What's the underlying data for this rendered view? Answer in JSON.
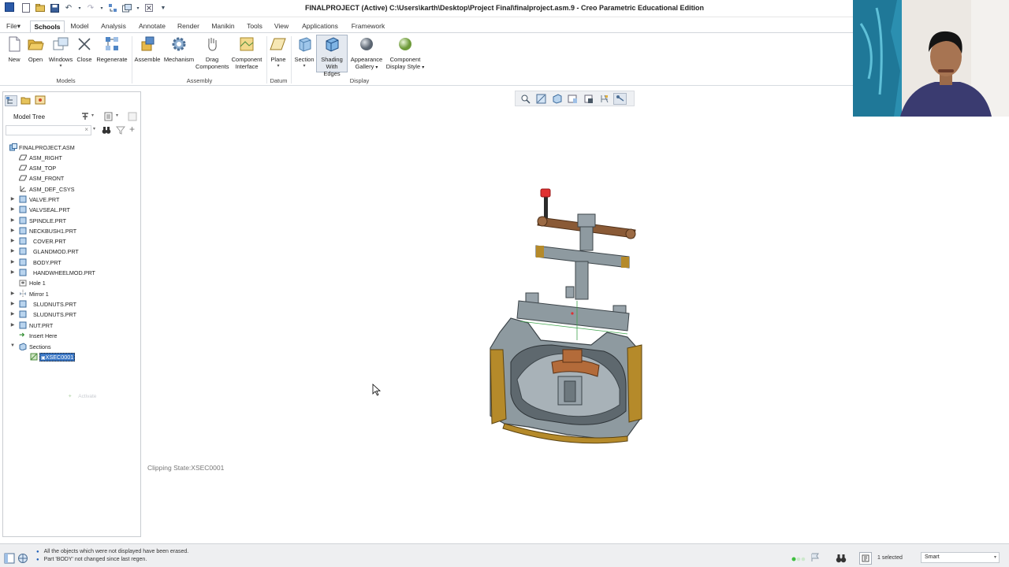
{
  "window": {
    "title": "FINALPROJECT (Active) C:\\Users\\karth\\Desktop\\Project Final\\finalproject.asm.9 - Creo Parametric Educational Edition"
  },
  "quick_access": [
    "new-icon",
    "open-icon",
    "save-icon",
    "undo-icon",
    "redo-icon",
    "regenerate-icon",
    "windows-icon",
    "close-icon",
    "customize-icon"
  ],
  "tabs": [
    {
      "label": "File"
    },
    {
      "label": "Schools"
    },
    {
      "label": "Model"
    },
    {
      "label": "Analysis"
    },
    {
      "label": "Annotate"
    },
    {
      "label": "Render"
    },
    {
      "label": "Manikin"
    },
    {
      "label": "Tools"
    },
    {
      "label": "View"
    },
    {
      "label": "Applications"
    },
    {
      "label": "Framework"
    }
  ],
  "ribbon": {
    "buttons": [
      {
        "l1": "New",
        "l2": ""
      },
      {
        "l1": "Open",
        "l2": ""
      },
      {
        "l1": "Windows",
        "l2": ""
      },
      {
        "l1": "Close",
        "l2": ""
      },
      {
        "l1": "Regenerate",
        "l2": ""
      },
      {
        "l1": "Assemble",
        "l2": ""
      },
      {
        "l1": "Mechanism",
        "l2": ""
      },
      {
        "l1": "Drag",
        "l2": "Components"
      },
      {
        "l1": "Component",
        "l2": "Interface"
      },
      {
        "l1": "Plane",
        "l2": ""
      },
      {
        "l1": "Section",
        "l2": ""
      },
      {
        "l1": "Shading",
        "l2": "With Edges"
      },
      {
        "l1": "Appearance",
        "l2": "Gallery"
      },
      {
        "l1": "Component",
        "l2": "Display Style"
      }
    ],
    "groups": [
      "Models",
      "Assembly",
      "Datum",
      "Display"
    ]
  },
  "model_tree": {
    "title": "Model Tree",
    "items": [
      {
        "label": "FINALPROJECT.ASM"
      },
      {
        "label": "ASM_RIGHT"
      },
      {
        "label": "ASM_TOP"
      },
      {
        "label": "ASM_FRONT"
      },
      {
        "label": "ASM_DEF_CSYS"
      },
      {
        "label": "VALVE.PRT"
      },
      {
        "label": "VALVSEAL.PRT"
      },
      {
        "label": "SPINDLE.PRT"
      },
      {
        "label": "NECKBUSH1.PRT"
      },
      {
        "label": "COVER.PRT"
      },
      {
        "label": "GLANDMOD.PRT"
      },
      {
        "label": "BODY.PRT"
      },
      {
        "label": "HANDWHEELMOD.PRT"
      },
      {
        "label": "Hole 1"
      },
      {
        "label": "Mirror 1"
      },
      {
        "label": "SLUDNUTS.PRT"
      },
      {
        "label": "SLUDNUTS.PRT"
      },
      {
        "label": "NUT.PRT"
      },
      {
        "label": "Insert Here"
      },
      {
        "label": "Sections"
      },
      {
        "label": "XSEC0001"
      }
    ],
    "activate_label": "Activate"
  },
  "graphics": {
    "clipping_state": "Clipping State:XSEC0001"
  },
  "status": {
    "messages": [
      "All the objects which were not displayed have been erased.",
      "Part 'BODY' not changed since last regen."
    ],
    "selected": "1 selected",
    "filter": "Smart"
  },
  "colors": {
    "accent": "#2b5aa8",
    "part_gray": "#8e9aa0",
    "flange_gold": "#b58a2a",
    "handwheel_brown": "#8a5a36",
    "knob_red": "#e03030"
  }
}
